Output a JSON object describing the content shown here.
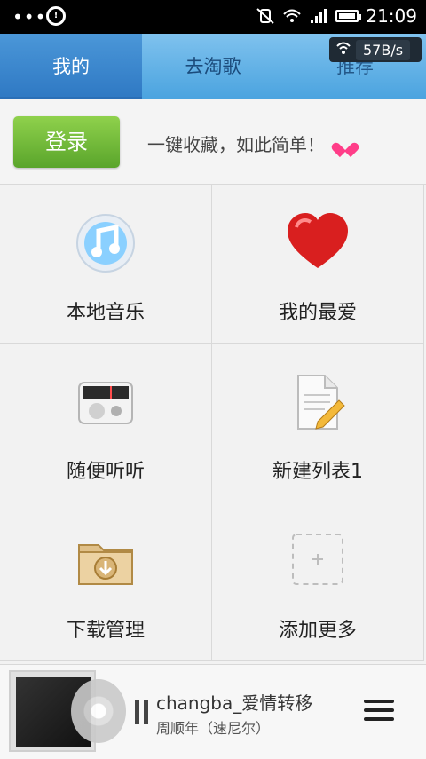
{
  "statusbar": {
    "time": "21:09",
    "left_dots": "•••",
    "carrier_glyph": "!",
    "signal_icon": "signal-icon",
    "wifi_icon": "wifi-icon",
    "battery_icon": "battery-icon"
  },
  "tabs": [
    {
      "label": "我的"
    },
    {
      "label": "去淘歌"
    },
    {
      "label": "推荐"
    }
  ],
  "speed": {
    "value": "57B/s"
  },
  "login": {
    "button_label": "登录",
    "slogan": "一键收藏，如此简单！"
  },
  "grid": [
    {
      "label": "本地音乐",
      "icon": "itunes-music-icon"
    },
    {
      "label": "我的最爱",
      "icon": "heart-icon"
    },
    {
      "label": "随便听听",
      "icon": "radio-icon"
    },
    {
      "label": "新建列表1",
      "icon": "playlist-document-icon"
    },
    {
      "label": "下载管理",
      "icon": "download-folder-icon"
    },
    {
      "label": "添加更多",
      "icon": "add-more-icon"
    }
  ],
  "player": {
    "title": "changba_爱情转移",
    "artist": "周顺年（速尼尔）"
  },
  "colors": {
    "tab_active": "#2e78c3",
    "tab_inactive": "#4aa3df",
    "login_green": "#5aa52b",
    "heart_red": "#d91f1f"
  }
}
